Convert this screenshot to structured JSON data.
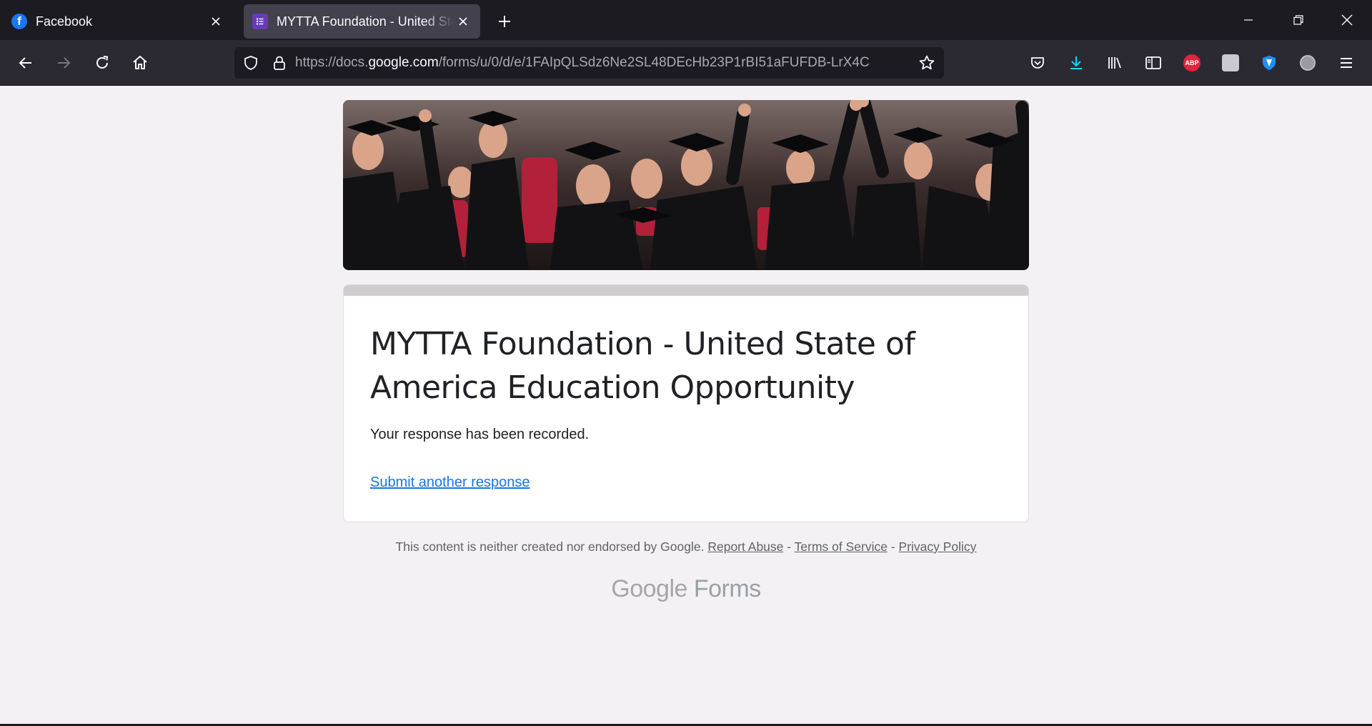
{
  "browser": {
    "tabs": [
      {
        "title": "Facebook",
        "favicon": "facebook-icon"
      },
      {
        "title": "MYTTA Foundation - United States of America Education Opportunity",
        "favicon": "google-forms-icon"
      }
    ],
    "url_scheme": "https://docs.",
    "url_host": "google.com",
    "url_path": "/forms/u/0/d/e/1FAIpQLSdz6Ne2SL48DEcHb23P1rBI51aFUFDB-LrX4C",
    "extensions": [
      "pocket-icon",
      "download-icon",
      "library-icon",
      "sidebar-icon",
      "adblock-plus-icon",
      "extension-icon",
      "shield-vpn-icon",
      "globe-icon",
      "menu-icon"
    ],
    "abp_label": "ABP",
    "accent_color": "#00ddff"
  },
  "form": {
    "title": "MYTTA Foundation - United State of America Education Opportunity",
    "confirmation": "Your response has been recorded.",
    "submit_another": "Submit another response",
    "banner": "graduation-crowd-image",
    "theme_color": "#d1cccd"
  },
  "footer": {
    "disclaimer": "This content is neither created nor endorsed by Google.",
    "report_abuse": "Report Abuse",
    "sep1": " - ",
    "terms": "Terms of Service",
    "sep2": " - ",
    "privacy": "Privacy Policy",
    "brand_google": "Google",
    "brand_forms": "Forms"
  }
}
